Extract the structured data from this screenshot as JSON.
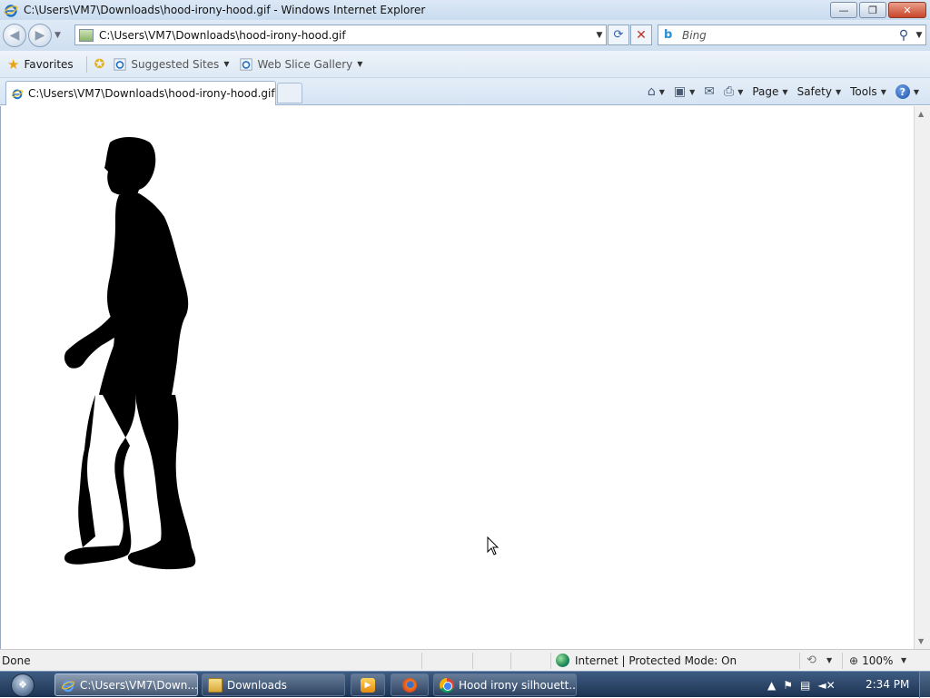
{
  "window": {
    "title": "C:\\Users\\VM7\\Downloads\\hood-irony-hood.gif - Windows Internet Explorer",
    "minimize_symbol": "—",
    "restore_symbol": "❐",
    "close_symbol": "✕"
  },
  "address_bar": {
    "url": "C:\\Users\\VM7\\Downloads\\hood-irony-hood.gif",
    "search_placeholder": "Bing"
  },
  "favorites_bar": {
    "favorites_label": "Favorites",
    "suggested_sites_label": "Suggested Sites",
    "web_slice_gallery_label": "Web Slice Gallery"
  },
  "tabs": [
    {
      "label": "C:\\Users\\VM7\\Downloads\\hood-irony-hood.gif",
      "active": true
    }
  ],
  "command_bar": {
    "page_label": "Page",
    "safety_label": "Safety",
    "tools_label": "Tools",
    "help_label": "?"
  },
  "status_bar": {
    "status_text": "Done",
    "zone_text": "Internet | Protected Mode: On",
    "zoom_text": "100%"
  },
  "taskbar": {
    "items": [
      {
        "label": "C:\\Users\\VM7\\Down...",
        "icon": "ie-icon",
        "active": true
      },
      {
        "label": "Downloads",
        "icon": "folder-icon",
        "active": false
      },
      {
        "label": "",
        "icon": "media-player-icon",
        "active": false
      },
      {
        "label": "",
        "icon": "firefox-icon",
        "active": false
      },
      {
        "label": "Hood irony silhouett...",
        "icon": "chrome-icon",
        "active": false
      }
    ],
    "clock": "2:34 PM"
  },
  "icons": {
    "ie_brand": "#1f6fc5",
    "ie_ring": "#f5c21b"
  }
}
